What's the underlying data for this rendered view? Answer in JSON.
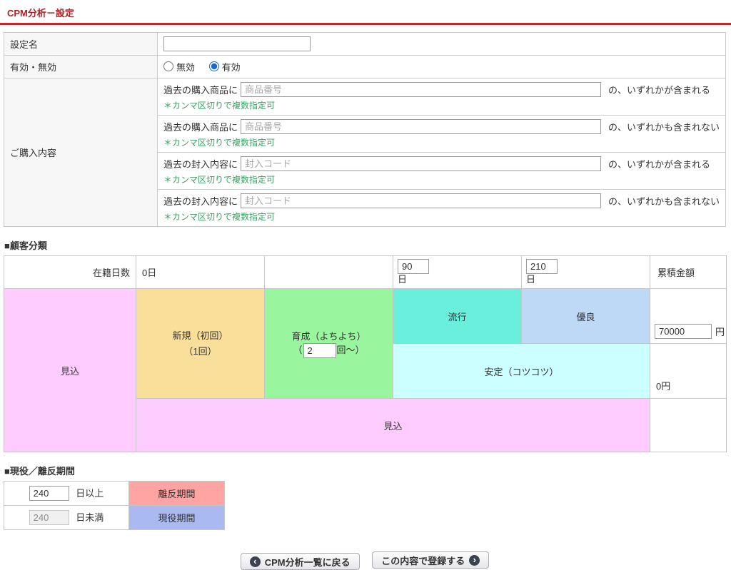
{
  "page": {
    "title": "CPM分析－設定"
  },
  "settings_form": {
    "name": {
      "label": "設定名",
      "value": ""
    },
    "enabled": {
      "label": "有効・無効",
      "options": [
        {
          "label": "無効",
          "checked": false
        },
        {
          "label": "有効",
          "checked": true
        }
      ]
    },
    "purchase": {
      "label": "ご購入内容",
      "note": "＊カンマ区切りで複数指定可",
      "conditions": [
        {
          "prefix": "過去の購入商品に",
          "placeholder": "商品番号",
          "value": "",
          "suffix": "の、いずれかが含まれる"
        },
        {
          "prefix": "過去の購入商品に",
          "placeholder": "商品番号",
          "value": "",
          "suffix": "の、いずれかも含まれない"
        },
        {
          "prefix": "過去の封入内容に",
          "placeholder": "封入コード",
          "value": "",
          "suffix": "の、いずれかが含まれる"
        },
        {
          "prefix": "過去の封入内容に",
          "placeholder": "封入コード",
          "value": "",
          "suffix": "の、いずれかも含まれない"
        }
      ]
    }
  },
  "classification": {
    "heading": "■顧客分類",
    "header": {
      "tenure_label": "在籍日数",
      "day0": "0日",
      "day90": "90",
      "day210": "210",
      "day_unit": "日",
      "amount_label": "累積金額"
    },
    "cells": {
      "prospect_left": "見込",
      "new_line1": "新規（初回）",
      "new_line2": "（1回）",
      "nurture_line1": "育成（よちよち）",
      "nurture_open": "（",
      "nurture_count": "2",
      "nurture_close": "回～）",
      "trend": "流行",
      "excellent": "優良",
      "stable": "安定（コツコツ）",
      "prospect_bottom": "見込",
      "amount_value": "70000",
      "amount_unit": "円",
      "amount_zero": "0円"
    },
    "colors": {
      "prospect": "#FFCCFF",
      "new_customer": "#FADF9B",
      "nurture": "#99F59E",
      "trend": "#6AEFDC",
      "excellent": "#BED9F6",
      "stable": "#CCFFFF"
    }
  },
  "period": {
    "heading": "■現役／離反期間",
    "rows": [
      {
        "value": "240",
        "label": "日以上",
        "badge": "離反期間",
        "color": "#FFA3A3"
      },
      {
        "value": "240",
        "label": "日未満",
        "badge": "現役期間",
        "color": "#AAB9F0"
      }
    ]
  },
  "footer": {
    "back_label": "CPM分析一覧に戻る",
    "submit_label": "この内容で登録する"
  }
}
